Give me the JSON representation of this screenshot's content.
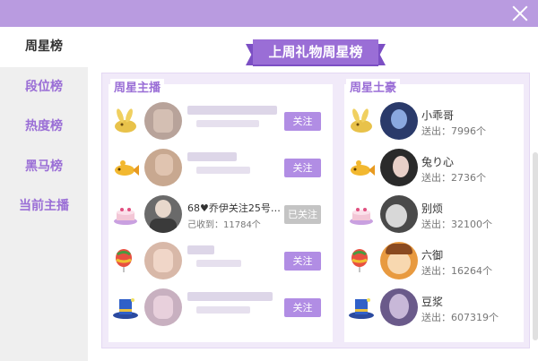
{
  "sidebar": {
    "items": [
      {
        "label": "周星榜"
      },
      {
        "label": "段位榜"
      },
      {
        "label": "热度榜"
      },
      {
        "label": "黑马榜"
      },
      {
        "label": "当前主播"
      }
    ]
  },
  "main": {
    "banner_title": "上周礼物周星榜"
  },
  "anchors": {
    "title": "周星主播",
    "rows": [
      {
        "name": "",
        "sub": "",
        "follow": "关注",
        "followed": false,
        "icon": "rabbit-gift-icon"
      },
      {
        "name": "",
        "sub": "",
        "follow": "关注",
        "followed": false,
        "icon": "goldfish-gift-icon"
      },
      {
        "name": "68♥乔伊关注25号…",
        "sub": "己收到：11784个",
        "follow": "已关注",
        "followed": true,
        "icon": "cake-gift-icon"
      },
      {
        "name": "",
        "sub": "",
        "follow": "关注",
        "followed": false,
        "icon": "balloon-gift-icon"
      },
      {
        "name": "",
        "sub": "",
        "follow": "关注",
        "followed": false,
        "icon": "hat-gift-icon"
      }
    ]
  },
  "tycoons": {
    "title": "周星土豪",
    "rows": [
      {
        "name": "小乖哥",
        "sub": "送出：7996个",
        "icon": "rabbit-gift-icon"
      },
      {
        "name": "兔り心",
        "sub": "送出：2736个",
        "icon": "goldfish-gift-icon"
      },
      {
        "name": "别烦",
        "sub": "送出：32100个",
        "icon": "cake-gift-icon"
      },
      {
        "name": "六御",
        "sub": "送出：16264个",
        "icon": "balloon-gift-icon"
      },
      {
        "name": "豆浆",
        "sub": "送出：607319个",
        "icon": "hat-gift-icon"
      }
    ]
  },
  "colors": {
    "accent": "#9a6ed6",
    "titlebar": "#b99be0",
    "button": "#b18de4",
    "button_disabled": "#c4c4c4"
  }
}
